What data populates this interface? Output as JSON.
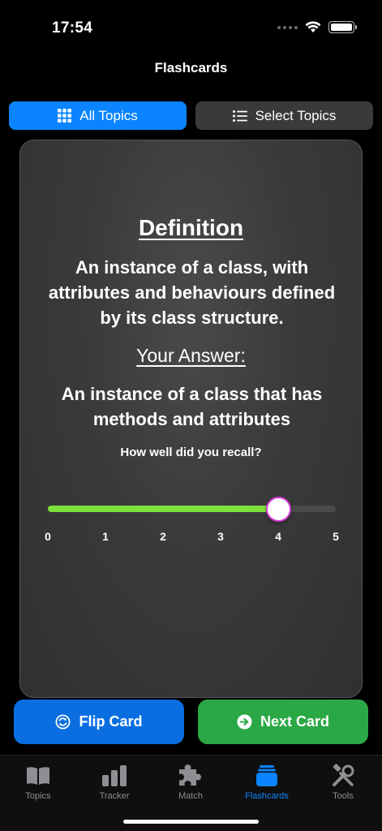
{
  "status_bar": {
    "time": "17:54"
  },
  "nav": {
    "title": "Flashcards"
  },
  "segment": {
    "all_topics": "All Topics",
    "select_topics": "Select Topics"
  },
  "card": {
    "definition_heading": "Definition",
    "definition_text": "An instance of a class, with attributes and behaviours defined by its class structure.",
    "answer_heading": "Your Answer:",
    "answer_text": "An instance of a class that has methods and attributes",
    "recall_question": "How well did you recall?",
    "slider": {
      "min": 0,
      "max": 5,
      "value": 4,
      "ticks": [
        "0",
        "1",
        "2",
        "3",
        "4",
        "5"
      ]
    }
  },
  "actions": {
    "flip_label": "Flip Card",
    "next_label": "Next Card"
  },
  "tabs": [
    {
      "label": "Topics",
      "icon": "book-icon"
    },
    {
      "label": "Tracker",
      "icon": "bar-chart-icon"
    },
    {
      "label": "Match",
      "icon": "puzzle-icon"
    },
    {
      "label": "Flashcards",
      "icon": "cards-stack-icon",
      "active": true
    },
    {
      "label": "Tools",
      "icon": "tools-icon"
    }
  ],
  "colors": {
    "accent": "#0a84ff",
    "slider_fill": "#7ee03a",
    "next_button": "#2aa845",
    "flip_button": "#0a6ee0"
  }
}
